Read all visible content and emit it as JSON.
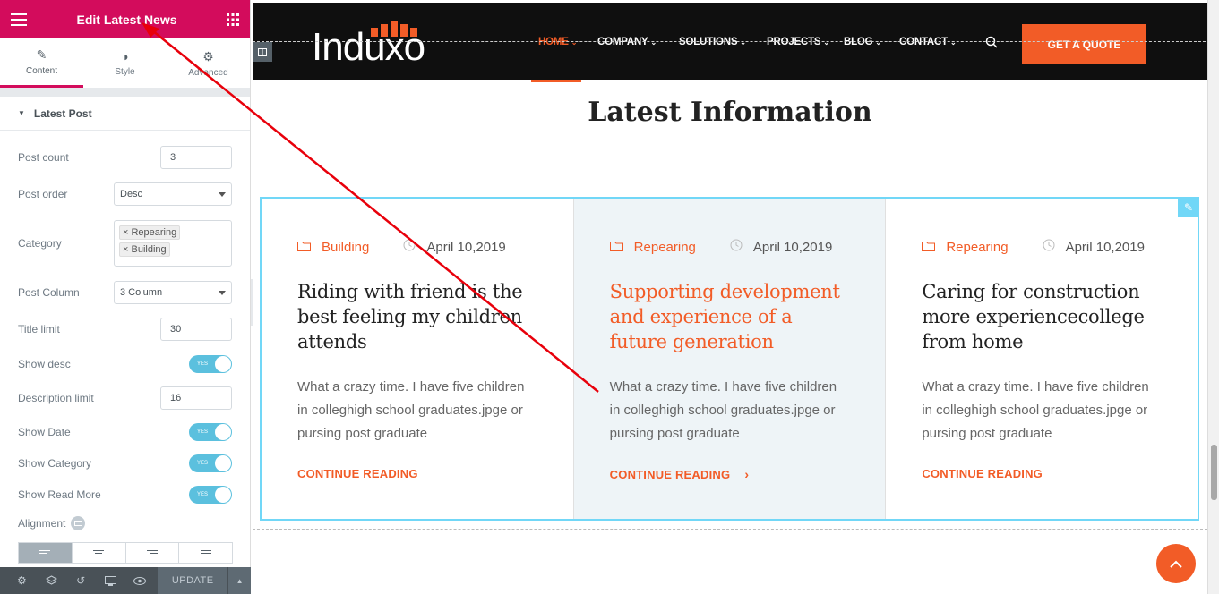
{
  "panel": {
    "title": "Edit Latest News",
    "tabs": [
      {
        "label": "Content",
        "icon": "pencil-icon"
      },
      {
        "label": "Style",
        "icon": "half-circle-icon"
      },
      {
        "label": "Advanced",
        "icon": "gear-icon"
      }
    ],
    "section_title": "Latest Post",
    "fields": {
      "post_count": {
        "label": "Post count",
        "value": "3"
      },
      "post_order": {
        "label": "Post order",
        "value": "Desc"
      },
      "category": {
        "label": "Category",
        "chips": [
          "Repearing",
          "Building"
        ]
      },
      "post_column": {
        "label": "Post Column",
        "value": "3 Column"
      },
      "title_limit": {
        "label": "Title limit",
        "value": "30"
      },
      "show_desc": {
        "label": "Show desc",
        "toggle": "YES"
      },
      "description_limit": {
        "label": "Description limit",
        "value": "16"
      },
      "show_date": {
        "label": "Show Date",
        "toggle": "YES"
      },
      "show_category": {
        "label": "Show Category",
        "toggle": "YES"
      },
      "show_read_more": {
        "label": "Show Read More",
        "toggle": "YES"
      },
      "alignment": {
        "label": "Alignment"
      }
    },
    "footer": {
      "update_label": "UPDATE"
    }
  },
  "site": {
    "logo": "Induxo",
    "menu": [
      {
        "label": "HOME",
        "active": true
      },
      {
        "label": "COMPANY"
      },
      {
        "label": "SOLUTIONS"
      },
      {
        "label": "PROJECTS"
      },
      {
        "label": "BLOG"
      },
      {
        "label": "CONTACT"
      }
    ],
    "quote_button": "GET A QUOTE",
    "heading_light": "Latest",
    "heading_bold": "Information",
    "posts": [
      {
        "category": "Building",
        "date": "April 10,2019",
        "title": "Riding with friend is the best feeling my children attends",
        "desc": "What a crazy time. I have five children in colleghigh school graduates.jpge or pursing post graduate",
        "more": "CONTINUE READING"
      },
      {
        "category": "Repearing",
        "date": "April 10,2019",
        "title": "Supporting development and experience of a future generation",
        "desc": "What a crazy time. I have five children in colleghigh school graduates.jpge or pursing post graduate",
        "more": "CONTINUE READING"
      },
      {
        "category": "Repearing",
        "date": "April 10,2019",
        "title": "Caring for construction more experiencecollege from home",
        "desc": "What a crazy time. I have five children in colleghigh school graduates.jpge or pursing post graduate",
        "more": "CONTINUE READING"
      }
    ]
  },
  "colors": {
    "elementor_pink": "#d30c5c",
    "accent_orange": "#f25c27",
    "toggle_blue": "#5bc0de",
    "annotation_red": "#e8000b"
  }
}
